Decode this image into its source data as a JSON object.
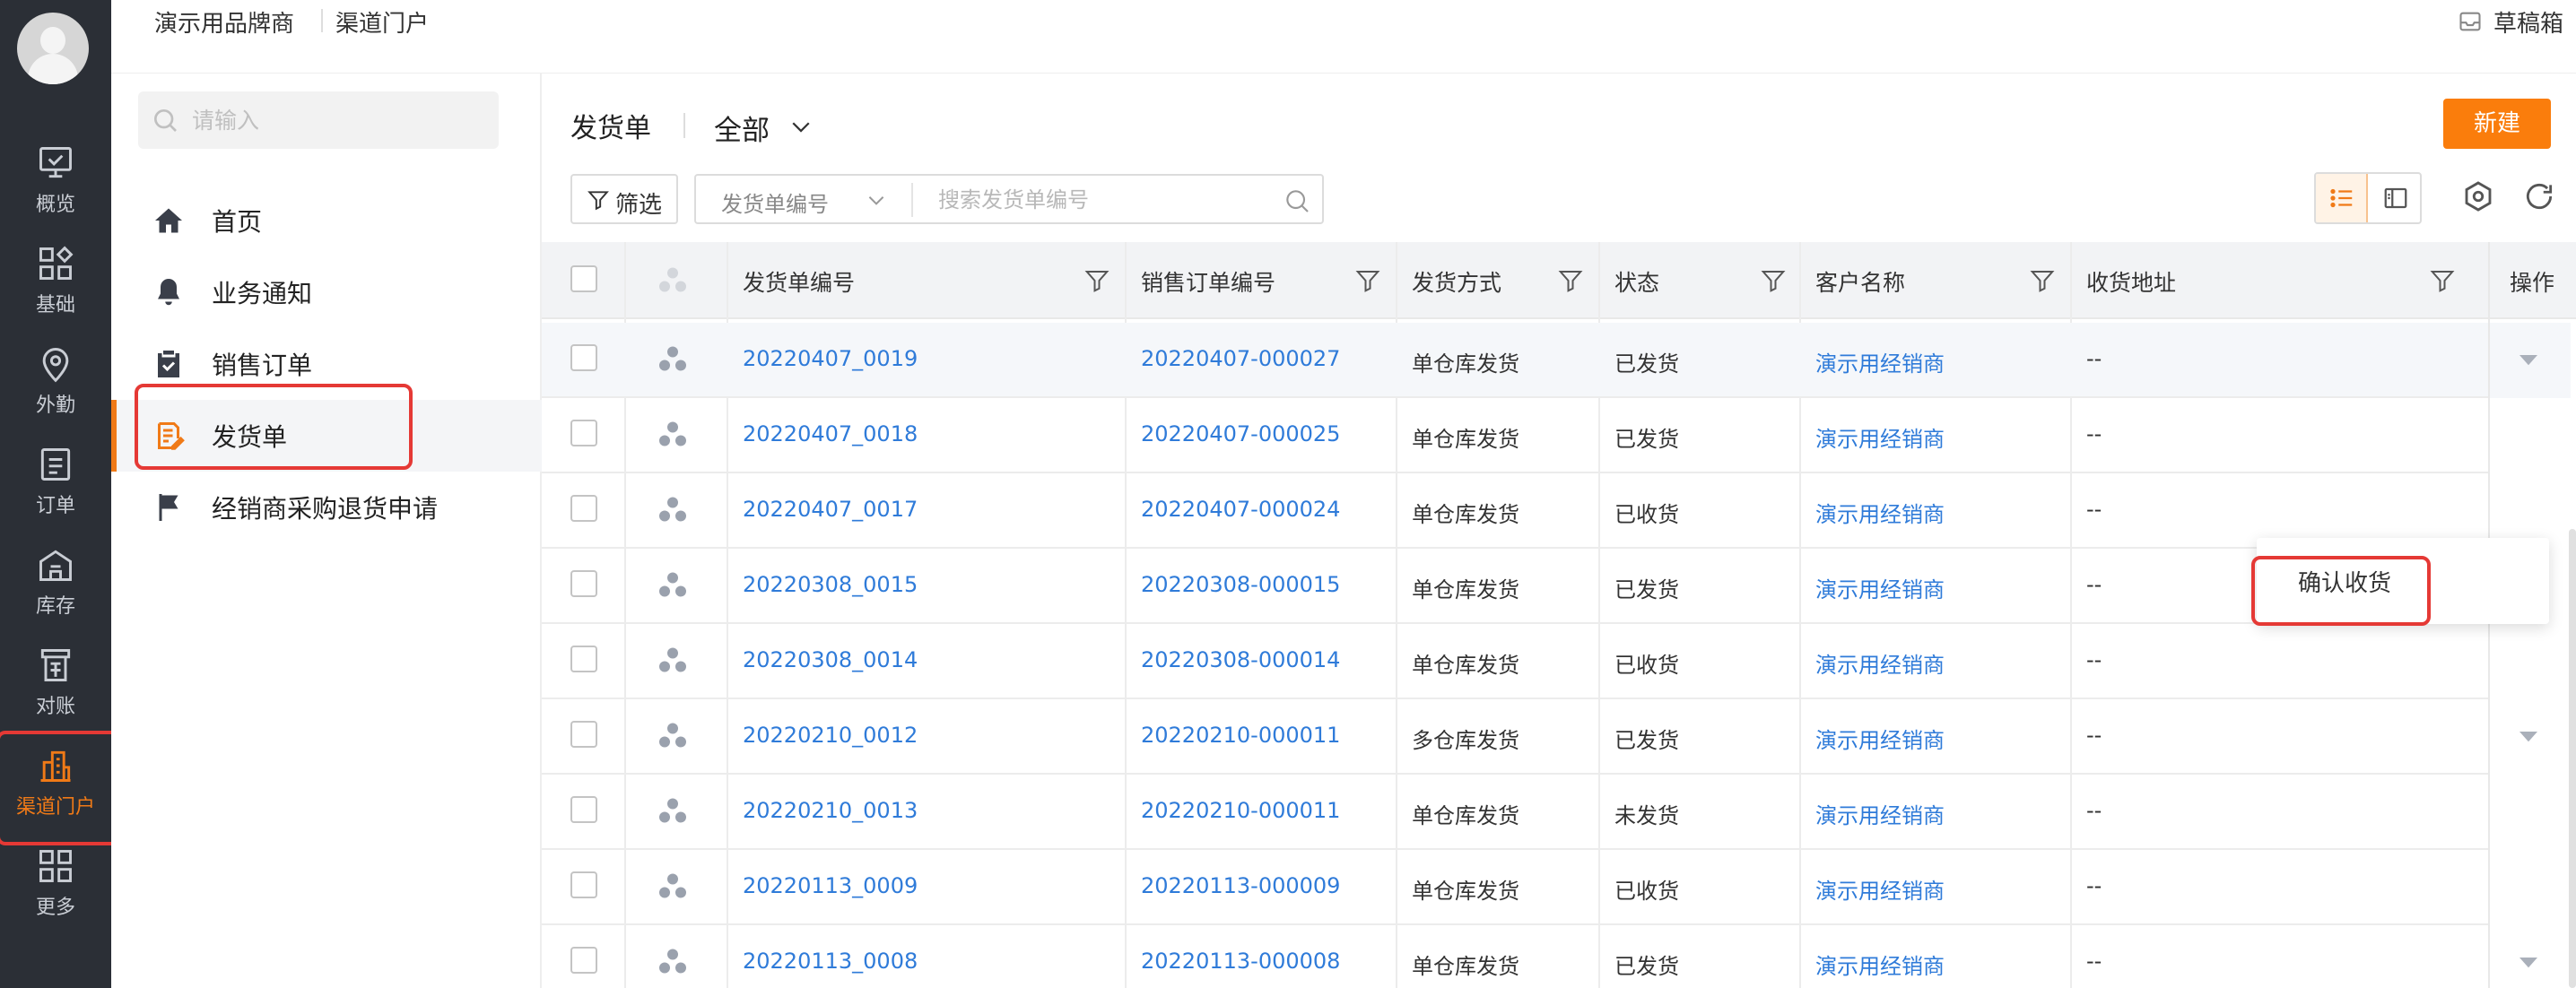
{
  "topbar": {
    "brand": "演示用品牌商",
    "crumb": "渠道门户",
    "drafts_label": "草稿箱"
  },
  "rail": {
    "items": [
      {
        "label": "概览",
        "icon": "monitor-check-icon"
      },
      {
        "label": "基础",
        "icon": "grid-icon"
      },
      {
        "label": "外勤",
        "icon": "location-pin-icon"
      },
      {
        "label": "订单",
        "icon": "document-icon"
      },
      {
        "label": "库存",
        "icon": "warehouse-icon"
      },
      {
        "label": "对账",
        "icon": "reconcile-icon"
      },
      {
        "label": "渠道门户",
        "icon": "building-icon",
        "active": true
      },
      {
        "label": "更多",
        "icon": "apps-icon"
      }
    ],
    "active_color": "#f07a17"
  },
  "sidenav": {
    "search_placeholder": "请输入",
    "items": [
      {
        "label": "首页",
        "icon": "home-icon"
      },
      {
        "label": "业务通知",
        "icon": "bell-icon"
      },
      {
        "label": "销售订单",
        "icon": "clipboard-check-icon"
      },
      {
        "label": "发货单",
        "icon": "delivery-note-icon",
        "active": true
      },
      {
        "label": "经销商采购退货申请",
        "icon": "flag-icon"
      }
    ]
  },
  "main": {
    "title": "发货单",
    "scope": "全部",
    "new_button": "新建",
    "filter_button": "筛选",
    "search_field": "发货单编号",
    "search_placeholder": "搜索发货单编号",
    "accent": "#fa7d0c"
  },
  "table": {
    "columns": [
      "发货单编号",
      "销售订单编号",
      "发货方式",
      "状态",
      "客户名称",
      "收货地址",
      "操作"
    ],
    "rows": [
      {
        "no": "20220407_0019",
        "order": "20220407-000027",
        "method": "单仓库发货",
        "status": "已发货",
        "customer": "演示用经销商",
        "address": "--",
        "cut": "2",
        "expand": true
      },
      {
        "no": "20220407_0018",
        "order": "20220407-000025",
        "method": "单仓库发货",
        "status": "已发货",
        "customer": "演示用经销商",
        "address": "--",
        "cut": "",
        "expand": false
      },
      {
        "no": "20220407_0017",
        "order": "20220407-000024",
        "method": "单仓库发货",
        "status": "已收货",
        "customer": "演示用经销商",
        "address": "--",
        "cut": "2",
        "expand": false
      },
      {
        "no": "20220308_0015",
        "order": "20220308-000015",
        "method": "单仓库发货",
        "status": "已发货",
        "customer": "演示用经销商",
        "address": "--",
        "cut": "2",
        "expand": true
      },
      {
        "no": "20220308_0014",
        "order": "20220308-000014",
        "method": "单仓库发货",
        "status": "已收货",
        "customer": "演示用经销商",
        "address": "--",
        "cut": "2",
        "expand": false
      },
      {
        "no": "20220210_0012",
        "order": "20220210-000011",
        "method": "多仓库发货",
        "status": "已发货",
        "customer": "演示用经销商",
        "address": "--",
        "cut": "2",
        "expand": true
      },
      {
        "no": "20220210_0013",
        "order": "20220210-000011",
        "method": "单仓库发货",
        "status": "未发货",
        "customer": "演示用经销商",
        "address": "--",
        "cut": "2",
        "expand": false
      },
      {
        "no": "20220113_0009",
        "order": "20220113-000009",
        "method": "单仓库发货",
        "status": "已收货",
        "customer": "演示用经销商",
        "address": "--",
        "cut": "2",
        "expand": false
      },
      {
        "no": "20220113_0008",
        "order": "20220113-000008",
        "method": "单仓库发货",
        "status": "已发货",
        "customer": "演示用经销商",
        "address": "--",
        "cut": "2",
        "expand": true
      }
    ],
    "row_menu": {
      "item": "确认收货"
    },
    "link_color": "#2f7bd9"
  }
}
